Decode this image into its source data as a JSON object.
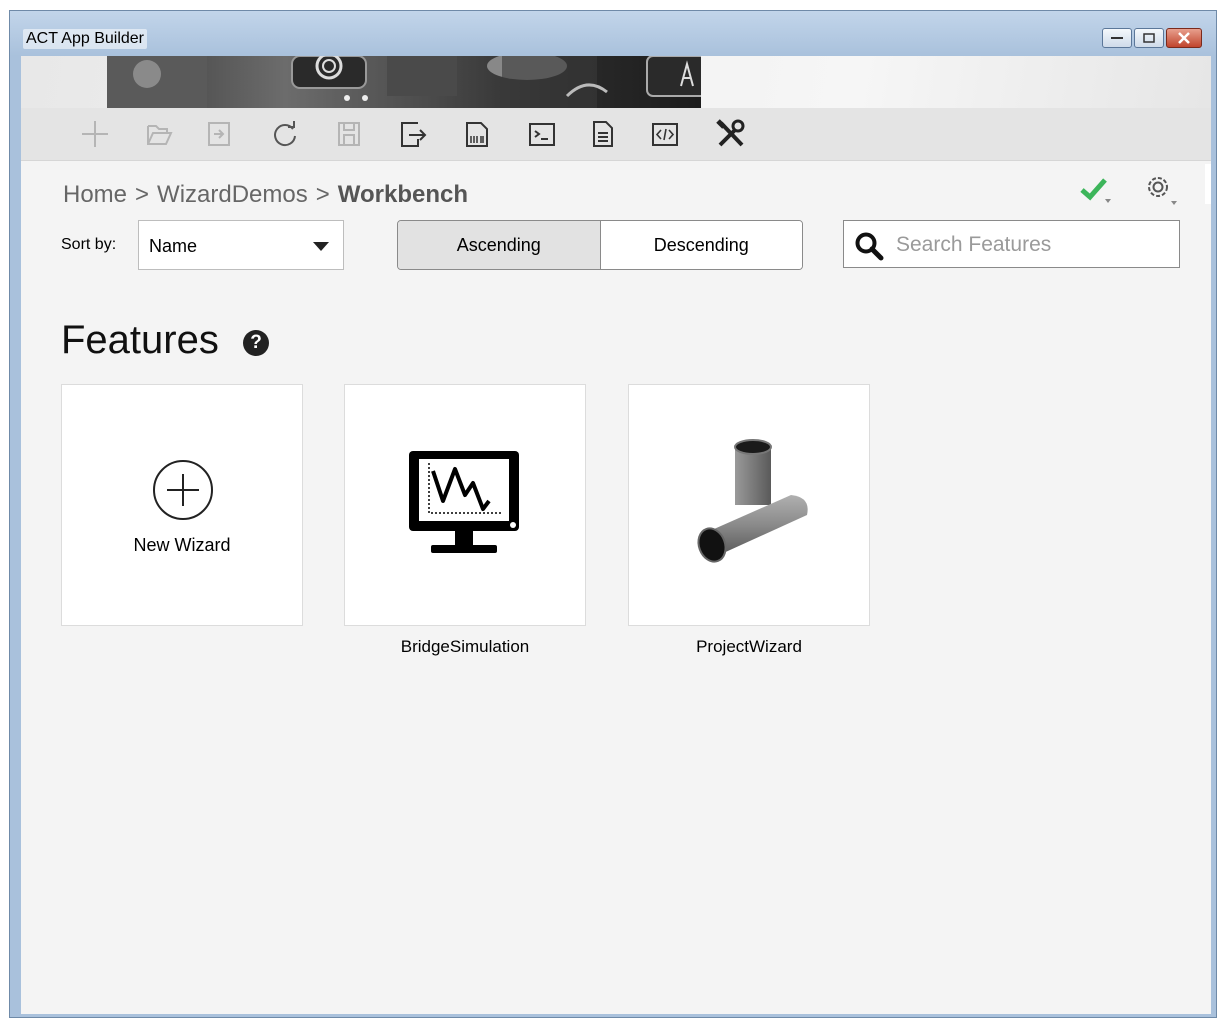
{
  "window": {
    "title": "ACT App Builder",
    "controls": {
      "minimize": "minimize",
      "maximize": "maximize",
      "close": "close"
    }
  },
  "toolbar": {
    "buttons": [
      {
        "name": "add",
        "icon": "plus-icon"
      },
      {
        "name": "open",
        "icon": "folder-open-icon"
      },
      {
        "name": "import",
        "icon": "import-icon"
      },
      {
        "name": "refresh",
        "icon": "refresh-icon"
      },
      {
        "name": "save",
        "icon": "save-icon"
      },
      {
        "name": "export",
        "icon": "export-icon"
      },
      {
        "name": "build",
        "icon": "build-icon"
      },
      {
        "name": "console",
        "icon": "console-icon"
      },
      {
        "name": "document",
        "icon": "document-icon"
      },
      {
        "name": "code",
        "icon": "code-icon"
      },
      {
        "name": "tools",
        "icon": "tools-icon"
      }
    ],
    "status_icon": "checkmark-icon",
    "status_color": "#3cb55a",
    "settings_icon": "gear-icon"
  },
  "breadcrumb": {
    "items": [
      "Home",
      "WizardDemos",
      "Workbench"
    ],
    "separator": ">"
  },
  "sort": {
    "label": "Sort by:",
    "selected": "Name",
    "order_options": [
      "Ascending",
      "Descending"
    ],
    "active_order": "Ascending"
  },
  "search": {
    "placeholder": "Search Features",
    "value": ""
  },
  "features": {
    "heading": "Features",
    "help_icon": "?",
    "new_wizard_label": "New Wizard",
    "items": [
      {
        "label": "BridgeSimulation",
        "icon": "monitor-chart-icon"
      },
      {
        "label": "ProjectWizard",
        "icon": "pipe-tee-icon"
      }
    ]
  }
}
